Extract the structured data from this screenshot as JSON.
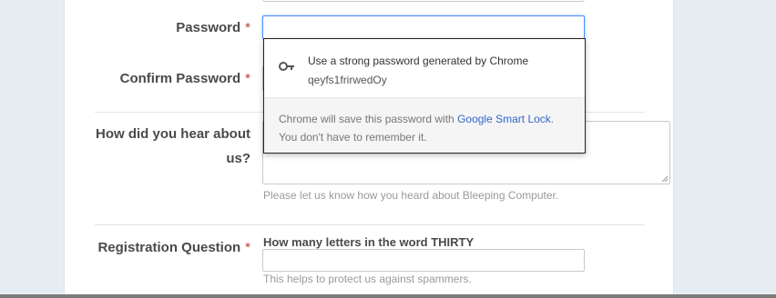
{
  "form": {
    "password_label": "Password",
    "confirm_password_label": "Confirm Password",
    "required_marker": "*",
    "how_heard_label_line1": "How did you hear about",
    "how_heard_label_line2": "us?",
    "how_heard_help": "Please let us know how you heard about Bleeping Computer.",
    "registration_question_label": "Registration Question",
    "registration_question_text": "How many letters in the word THIRTY",
    "registration_help": "This helps to protect us against spammers.",
    "password_value": "",
    "registration_answer_value": ""
  },
  "popup": {
    "title": "Use a strong password generated by Chrome",
    "generated_password": "qeyfs1frirwedOy",
    "footer_text_before": "Chrome will save this password with ",
    "footer_link": "Google Smart Lock",
    "footer_text_after": ". You don't have to remember it.",
    "icon": "key-icon"
  },
  "colors": {
    "required": "#c0392b",
    "link": "#3366cc",
    "focus_border": "#4d90fe",
    "page_background": "#e6edf2"
  }
}
